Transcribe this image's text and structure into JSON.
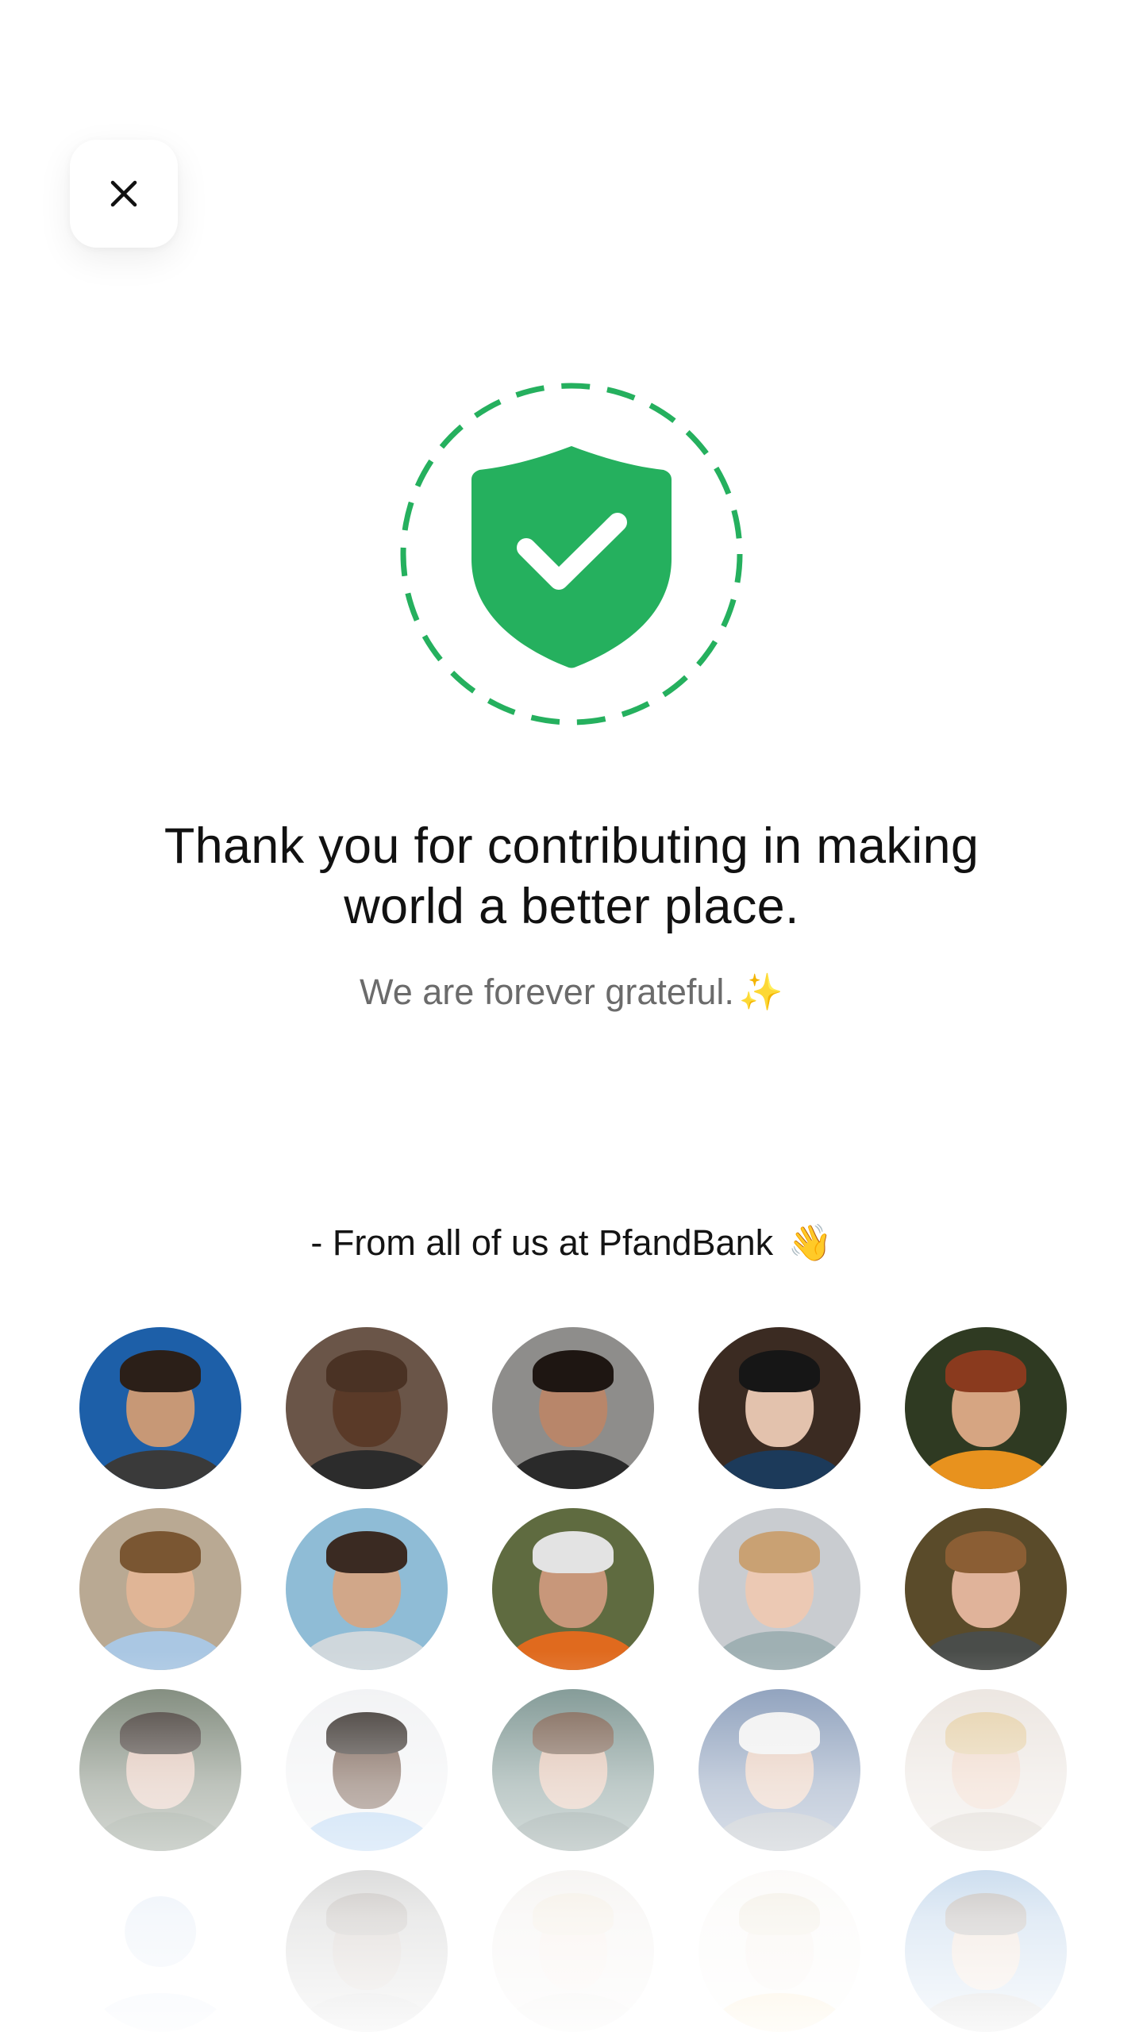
{
  "close_button": {
    "icon": "close-icon",
    "label": "Close"
  },
  "badge": {
    "icon": "shield-check-icon",
    "accent_color": "#25b05e"
  },
  "headline": {
    "line1": "Thank you for contributing in making",
    "line2": "world a better place."
  },
  "subline": {
    "text": "We are forever grateful.",
    "emoji": "✨"
  },
  "signoff": {
    "text": "- From all of us at PfandBank",
    "emoji": "👋"
  },
  "team_avatars": [
    {
      "bg": "#1d5fa8",
      "skin": "#c79876",
      "hair": "#2b1f18",
      "shirt": "#3a3a3a"
    },
    {
      "bg": "#6a5548",
      "skin": "#5a3a28",
      "hair": "#4a3224",
      "shirt": "#2c2c2c"
    },
    {
      "bg": "#8e8d8b",
      "skin": "#b8866a",
      "hair": "#1e1612",
      "shirt": "#2a2a2a"
    },
    {
      "bg": "#3b2b22",
      "skin": "#e3c2ad",
      "hair": "#161616",
      "shirt": "#1c3a5a"
    },
    {
      "bg": "#2f3a22",
      "skin": "#d6a582",
      "hair": "#8a3a1e",
      "shirt": "#e8921e"
    },
    {
      "bg": "#b9a993",
      "skin": "#e0b596",
      "hair": "#7a5632",
      "shirt": "#aac7e3"
    },
    {
      "bg": "#8fbcd6",
      "skin": "#d1a789",
      "hair": "#3a2a22",
      "shirt": "#cfd7dc"
    },
    {
      "bg": "#5f6b40",
      "skin": "#c8977a",
      "hair": "#e3e3e3",
      "shirt": "#e06a1e"
    },
    {
      "bg": "#c9ccd0",
      "skin": "#ecc9b4",
      "hair": "#c9a173",
      "shirt": "#9fb0b3"
    },
    {
      "bg": "#5a4b2a",
      "skin": "#e0b39a",
      "hair": "#8b5e34",
      "shirt": "#4a4d4a"
    },
    {
      "bg": "#6e7a6a",
      "skin": "#d8b8a8",
      "hair": "#2f2620",
      "shirt": "#5c6c5a"
    },
    {
      "bg": "#f0f1f3",
      "skin": "#5e4030",
      "hair": "#1f1712",
      "shirt": "#9ec6ee"
    },
    {
      "bg": "#6f8a86",
      "skin": "#d8b4a0",
      "hair": "#6a4e3c",
      "shirt": "#56706c"
    },
    {
      "bg": "#7e93b3",
      "skin": "#e2c2b0",
      "hair": "#eeeeee",
      "shirt": "#9aa3ad"
    },
    {
      "bg": "#e9e2dc",
      "skin": "#ecd0bf",
      "hair": "#e2cba0",
      "shirt": "#cfc6bc"
    },
    {
      "bg": "#ffffff",
      "skin": "#bcd0ea",
      "hair": "#bcd0ea",
      "shirt": "#bcd0ea",
      "placeholder": true
    },
    {
      "bg": "#7a7a78",
      "skin": "#6e5546",
      "hair": "#3a2c22",
      "shirt": "#585858"
    },
    {
      "bg": "#ded7d0",
      "skin": "#e6cbbb",
      "hair": "#d9c7a6",
      "shirt": "#c8c0b8"
    },
    {
      "bg": "#f1ede6",
      "skin": "#ead5c6",
      "hair": "#d8c9a8",
      "shirt": "#f2b53a"
    },
    {
      "bg": "#3e7fc1",
      "skin": "#c79876",
      "hair": "#2b1f18",
      "shirt": "#3a3a3a"
    }
  ]
}
